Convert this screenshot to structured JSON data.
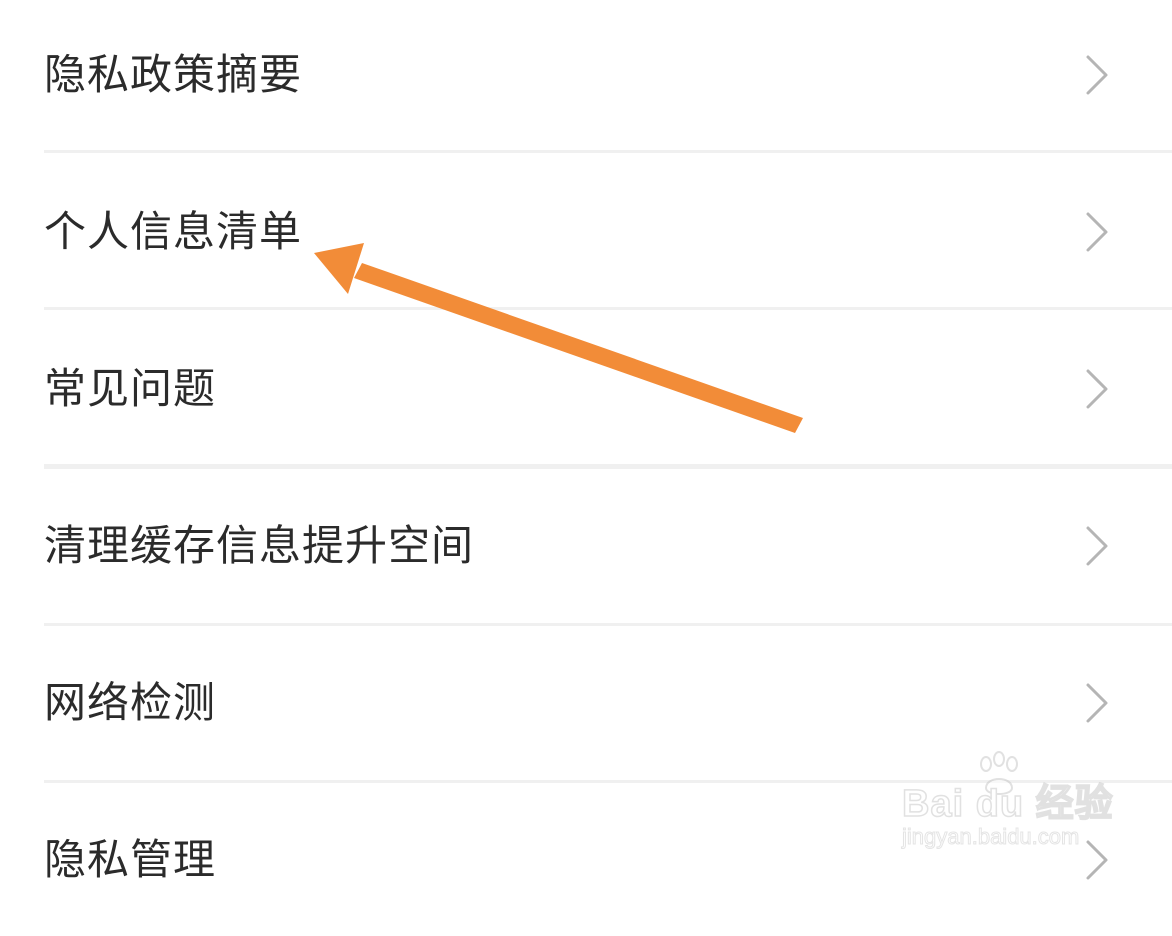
{
  "menu": {
    "items": [
      {
        "label": "隐私政策摘要"
      },
      {
        "label": "个人信息清单"
      },
      {
        "label": "常见问题"
      },
      {
        "label": "清理缓存信息提升空间"
      },
      {
        "label": "网络检测"
      },
      {
        "label": "隐私管理"
      }
    ]
  },
  "annotation": {
    "arrow_color": "#F28C38",
    "target": "个人信息清单"
  },
  "watermark": {
    "brand": "Bai  du 经验",
    "url": "jingyan.baidu.com"
  },
  "colors": {
    "label": "#2B2B2B",
    "chevron": "#B5B5B5",
    "divider": "#F0F0F0",
    "background": "#FFFFFF"
  }
}
